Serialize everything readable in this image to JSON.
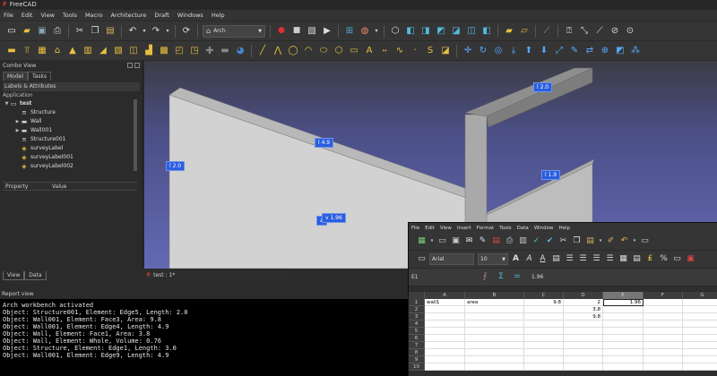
{
  "app": {
    "title": "FreeCAD"
  },
  "menu": [
    "File",
    "Edit",
    "View",
    "Tools",
    "Macro",
    "Architecture",
    "Draft",
    "Windows",
    "Help"
  ],
  "workbench": {
    "selected": "Arch"
  },
  "combo": {
    "title": "Combo View",
    "tabs": [
      "Model",
      "Tasks"
    ],
    "labels_header": "Labels & Attributes",
    "app_label": "Application",
    "tree": [
      {
        "label": "test",
        "icon": "document-icon",
        "expand": "▼",
        "indent": 4
      },
      {
        "label": "Structure",
        "icon": "structure-icon",
        "expand": "",
        "indent": 16
      },
      {
        "label": "Wall",
        "icon": "wall-icon",
        "expand": "▶",
        "indent": 16
      },
      {
        "label": "Wall001",
        "icon": "wall-icon",
        "expand": "▶",
        "indent": 16
      },
      {
        "label": "Structure001",
        "icon": "structure-icon",
        "expand": "",
        "indent": 16
      },
      {
        "label": "surveyLabel",
        "icon": "label-icon",
        "expand": "",
        "indent": 16
      },
      {
        "label": "surveyLabel001",
        "icon": "label-icon",
        "expand": "",
        "indent": 16
      },
      {
        "label": "surveyLabel002",
        "icon": "label-icon",
        "expand": "",
        "indent": 16
      }
    ],
    "prop_cols": [
      "Property",
      "Value"
    ],
    "bottom_tabs": [
      "View",
      "Data"
    ]
  },
  "viewport": {
    "labels": [
      {
        "text": "l 2.0",
        "name": "dim-label-beam"
      },
      {
        "text": "l 4.9",
        "name": "dim-label-wall-top"
      },
      {
        "text": "l 2.0",
        "name": "dim-label-wall-left"
      },
      {
        "text": "l 1.9",
        "name": "dim-label-wall2"
      },
      {
        "text": "a",
        "name": "area-label"
      },
      {
        "text": "v 1.96",
        "name": "volume-label"
      }
    ]
  },
  "doc_tab": "test : 1*",
  "report": {
    "title": "Report view",
    "lines": [
      "Arch workbench activated",
      "Object: Structure001, Element: Edge5, Length: 2.0",
      "Object: Wall001, Element: Face3, Area: 9.8",
      "Object: Wall001, Element: Edge4, Length: 4.9",
      "Object: Wall, Element: Face1, Area: 3.8",
      "Object: Wall, Element: Whole, Volume: 0.76",
      "Object: Structure, Element: Edge1, Length: 3.0",
      "Object: Wall001, Element: Edge9, Length: 4.9"
    ]
  },
  "sheet": {
    "menu": [
      "File",
      "Edit",
      "View",
      "Insert",
      "Format",
      "Tools",
      "Data",
      "Window",
      "Help"
    ],
    "font": "Arial",
    "size": "10",
    "cell_ref": "E1",
    "formula": "1.96",
    "columns": [
      "A",
      "B",
      "C",
      "D",
      "E",
      "F",
      "G"
    ],
    "rows": [
      {
        "n": "1",
        "A": "wall1",
        "B": "area",
        "C": "9.8",
        "D": "2",
        "E": "1.96"
      },
      {
        "n": "2",
        "A": "",
        "B": "",
        "C": "",
        "D": "3.8",
        "E": ""
      },
      {
        "n": "3",
        "A": "",
        "B": "",
        "C": "",
        "D": "9.8",
        "E": ""
      },
      {
        "n": "4",
        "A": "",
        "B": "",
        "C": "",
        "D": "",
        "E": ""
      },
      {
        "n": "5",
        "A": "",
        "B": "",
        "C": "",
        "D": "",
        "E": ""
      },
      {
        "n": "6",
        "A": "",
        "B": "",
        "C": "",
        "D": "",
        "E": ""
      },
      {
        "n": "7",
        "A": "",
        "B": "",
        "C": "",
        "D": "",
        "E": ""
      },
      {
        "n": "8",
        "A": "",
        "B": "",
        "C": "",
        "D": "",
        "E": ""
      },
      {
        "n": "9",
        "A": "",
        "B": "",
        "C": "",
        "D": "",
        "E": ""
      },
      {
        "n": "10",
        "A": "",
        "B": "",
        "C": "",
        "D": "",
        "E": ""
      }
    ]
  },
  "colors": {
    "accent_blue": "#2a5ee0",
    "record_red": "#e03030",
    "freecad_red": "#d43a2c",
    "viewport_top": "#3c3c46",
    "viewport_bottom": "#6468b4"
  }
}
